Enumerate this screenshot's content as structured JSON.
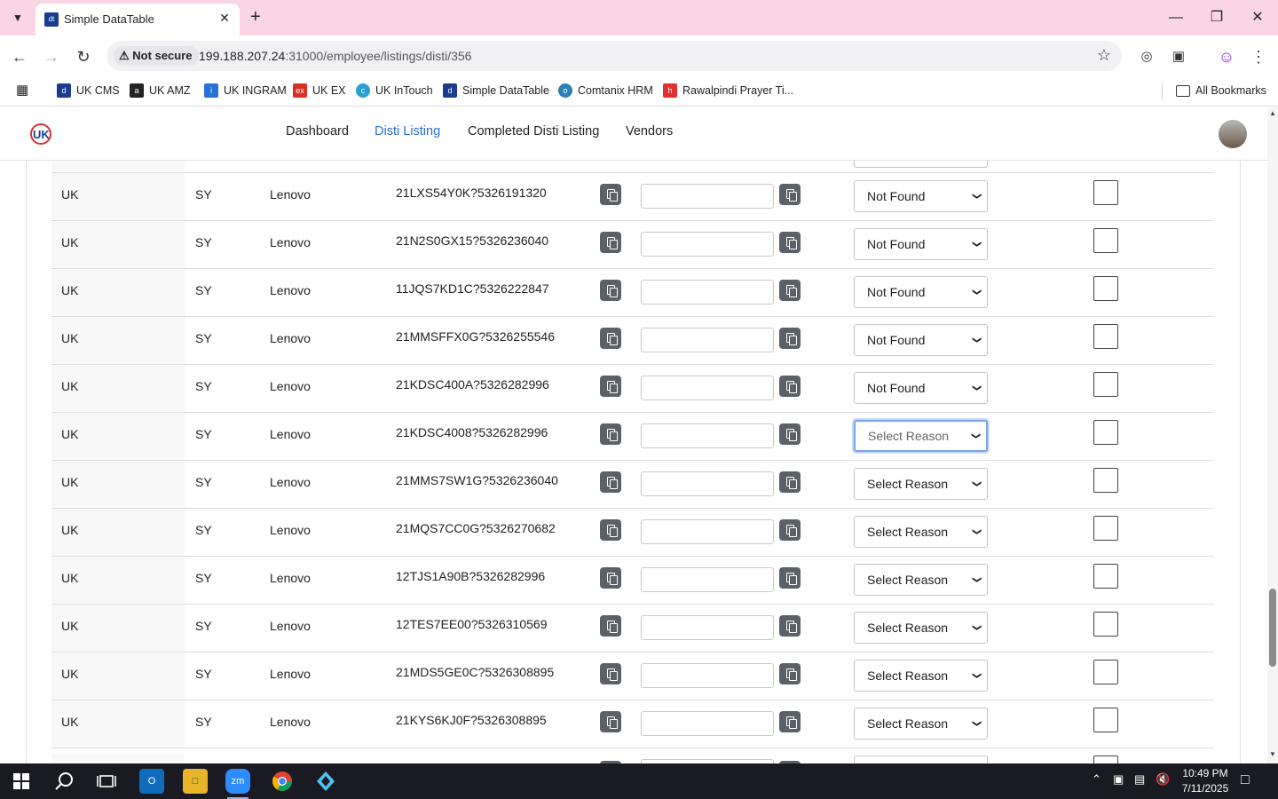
{
  "browser": {
    "tab_title": "Simple DataTable",
    "security_label": "Not secure",
    "url_host": "199.188.207.24",
    "url_path": ":31000/employee/listings/disti/356"
  },
  "bookmarks": [
    {
      "label": "UK CMS",
      "icon": "uk-cms-icon",
      "color": "#1a3d8f"
    },
    {
      "label": "UK AMZ",
      "icon": "amazon-icon",
      "color": "#222222"
    },
    {
      "label": "UK INGRAM",
      "icon": "ingram-icon",
      "color": "#2a6fd6"
    },
    {
      "label": "UK EX",
      "icon": "ex-icon",
      "color": "#d93025"
    },
    {
      "label": "UK InTouch",
      "icon": "intouch-icon",
      "color": "#2a9fd6"
    },
    {
      "label": "Simple DataTable",
      "icon": "datatable-icon",
      "color": "#1a3d8f"
    },
    {
      "label": "Comtanix HRM",
      "icon": "hrm-icon",
      "color": "#2a7fb8"
    },
    {
      "label": "Rawalpindi Prayer Ti...",
      "icon": "prayer-icon",
      "color": "#e03030"
    }
  ],
  "all_bookmarks_label": "All Bookmarks",
  "nav": {
    "items": [
      "Dashboard",
      "Disti Listing",
      "Completed Disti Listing",
      "Vendors"
    ],
    "active": "Disti Listing"
  },
  "rows": [
    {
      "region": "UK",
      "code": "SY",
      "vendor": "Lenovo",
      "sku": "21LXS54Y0K?5326191320",
      "reason": "Not Found",
      "checked": false
    },
    {
      "region": "UK",
      "code": "SY",
      "vendor": "Lenovo",
      "sku": "21N2S0GX15?5326236040",
      "reason": "Not Found",
      "checked": false
    },
    {
      "region": "UK",
      "code": "SY",
      "vendor": "Lenovo",
      "sku": "11JQS7KD1C?5326222847",
      "reason": "Not Found",
      "checked": false
    },
    {
      "region": "UK",
      "code": "SY",
      "vendor": "Lenovo",
      "sku": "21MMSFFX0G?5326255546",
      "reason": "Not Found",
      "checked": false
    },
    {
      "region": "UK",
      "code": "SY",
      "vendor": "Lenovo",
      "sku": "21KDSC400A?5326282996",
      "reason": "Not Found",
      "checked": false
    },
    {
      "region": "UK",
      "code": "SY",
      "vendor": "Lenovo",
      "sku": "21KDSC4008?5326282996",
      "reason": "Select Reason",
      "checked": false,
      "focused": true
    },
    {
      "region": "UK",
      "code": "SY",
      "vendor": "Lenovo",
      "sku": "21MMS7SW1G?5326236040",
      "reason": "Select Reason",
      "checked": false
    },
    {
      "region": "UK",
      "code": "SY",
      "vendor": "Lenovo",
      "sku": "21MQS7CC0G?5326270682",
      "reason": "Select Reason",
      "checked": false
    },
    {
      "region": "UK",
      "code": "SY",
      "vendor": "Lenovo",
      "sku": "12TJS1A90B?5326282996",
      "reason": "Select Reason",
      "checked": false
    },
    {
      "region": "UK",
      "code": "SY",
      "vendor": "Lenovo",
      "sku": "12TES7EE00?5326310569",
      "reason": "Select Reason",
      "checked": false
    },
    {
      "region": "UK",
      "code": "SY",
      "vendor": "Lenovo",
      "sku": "21MDS5GE0C?5326308895",
      "reason": "Select Reason",
      "checked": false
    },
    {
      "region": "UK",
      "code": "SY",
      "vendor": "Lenovo",
      "sku": "21KYS6KJ0F?5326308895",
      "reason": "Select Reason",
      "checked": false
    }
  ],
  "taskbar": {
    "time": "10:49 PM",
    "date": "7/11/2025",
    "apps": [
      "start-icon",
      "search-icon",
      "task-view-icon",
      "outlook-icon",
      "file-explorer-icon",
      "zoom-icon",
      "chrome-icon",
      "app-icon"
    ]
  }
}
